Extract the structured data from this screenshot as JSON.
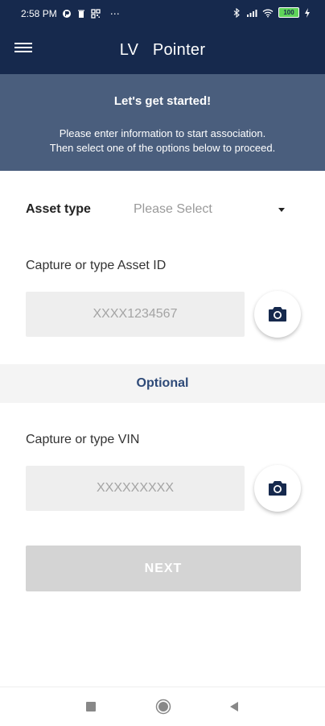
{
  "status_bar": {
    "time": "2:58 PM",
    "overflow": "⋯",
    "battery": "100",
    "icons": [
      "signal-icon",
      "trash-icon",
      "qr-icon",
      "bluetooth-icon",
      "cellular-icon",
      "wifi-icon",
      "battery-icon",
      "charging-icon"
    ]
  },
  "header": {
    "title": "LV   Pointer",
    "menu_icon": "hamburger-menu-icon"
  },
  "banner": {
    "title": "Let's get started!",
    "line1": "Please enter information to start association.",
    "line2": "Then select one of the options below to proceed."
  },
  "form": {
    "asset_type_label": "Asset type",
    "asset_type_value": "Please Select",
    "asset_id_label": "Capture or type Asset ID",
    "asset_id_placeholder": "XXXX1234567",
    "optional_label": "Optional",
    "vin_label": "Capture or type VIN",
    "vin_placeholder": "XXXXXXXXX",
    "next_label": "NEXT"
  },
  "colors": {
    "primary": "#16294d",
    "banner": "#4a5e7d",
    "accent_text": "#2e4a78",
    "disabled_button": "#d4d4d4"
  },
  "nav_bar": {
    "icons": [
      "recent-apps-icon",
      "home-icon",
      "back-icon"
    ]
  }
}
